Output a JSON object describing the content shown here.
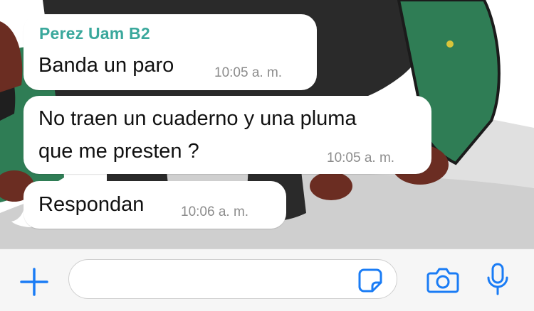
{
  "chat": {
    "messages": [
      {
        "sender": "Perez Uam B2",
        "lines": [
          "Banda un paro"
        ],
        "time": "10:05 a. m."
      },
      {
        "sender": "",
        "lines": [
          "No traen un cuaderno y una pluma",
          "que me presten ?"
        ],
        "time": "10:05 a. m."
      },
      {
        "sender": "",
        "lines": [
          "Respondan"
        ],
        "time": "10:06 a. m."
      }
    ]
  },
  "input_bar": {
    "message_value": "",
    "icons": {
      "add": "plus-icon",
      "sticker": "sticker-icon",
      "camera": "camera-icon",
      "microphone": "microphone-icon"
    },
    "accent_color": "#1a7cf5"
  },
  "colors": {
    "sender_name": "#3aa89c",
    "bubble_bg": "#ffffff",
    "timestamp": "#8c8c8c",
    "bar_bg": "#f6f6f6"
  }
}
